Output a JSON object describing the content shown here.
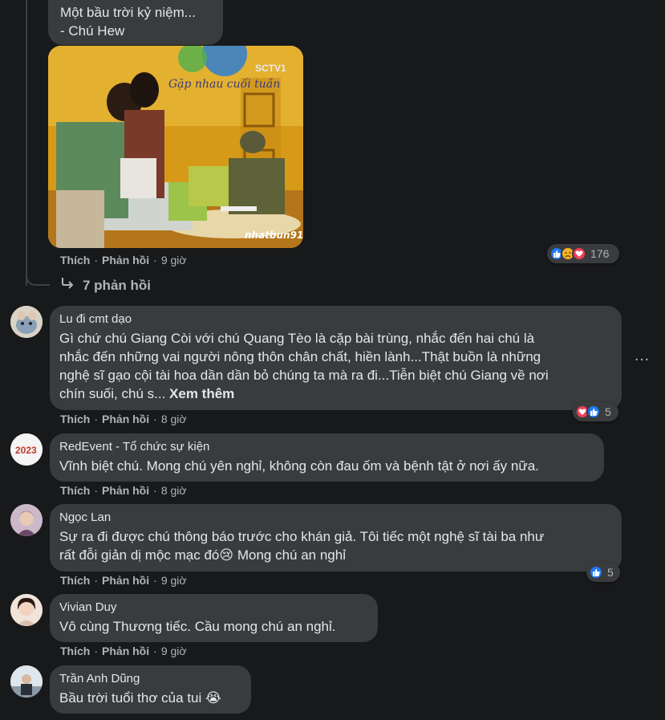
{
  "top_comment": {
    "text_line1": "Một bầu trời kỷ niệm...",
    "text_line2": "- Chú Hew",
    "video_watermark_top": "Gặp nhau cuối tuần",
    "video_channel": "SCTV1",
    "video_watermark": "nhatbun91",
    "actions": {
      "like": "Thích",
      "reply": "Phản hồi",
      "time": "9 giờ"
    },
    "reaction_count": "176"
  },
  "replies_toggle": {
    "label": "7 phản hồi"
  },
  "comments": [
    {
      "author": "Lu đi cmt dạo",
      "lines": [
        "Gì chứ chú Giang Còi với chú Quang Tèo là cặp bài trùng, nhắc đến hai chú là",
        "nhắc đến những vai người nông thôn chân chất, hiền lành...Thật buồn là những",
        "nghệ sĩ gạo cội tài hoa dần dần bỏ chúng ta mà ra đi...Tiễn biệt chú Giang về nơi",
        "chín suối, chú s..."
      ],
      "see_more": "Xem thêm",
      "time": "8 giờ",
      "reaction_count": "5",
      "more_icon": "…"
    },
    {
      "author": "RedEvent - Tổ chức sự kiện",
      "lines": [
        "Vĩnh biệt chú. Mong chú yên nghỉ, không còn đau ốm và bệnh tật ở nơi ấy nữa."
      ],
      "time": "8 giờ"
    },
    {
      "author": "Ngọc Lan",
      "lines": [
        "Sự ra đi được chú thông báo trước cho khán giả. Tôi tiếc một nghệ sĩ tài ba như",
        "rất đỗi giản dị mộc mạc đó😢 Mong chú an nghỉ"
      ],
      "time": "9 giờ",
      "reaction_count": "5"
    },
    {
      "author": "Vivian Duy",
      "lines": [
        "Vô cùng Thương tiếc. Cầu mong chú an nghỉ."
      ],
      "time": "9 giờ"
    },
    {
      "author": "Trần Anh Dũng",
      "lines": [
        "Bầu trời tuổi thơ của tui 😭"
      ]
    }
  ],
  "labels": {
    "like": "Thích",
    "reply": "Phản hồi"
  },
  "colors": {
    "background": "#18191a",
    "bubble": "#3a3b3c",
    "secondary_text": "#b0b3b8",
    "like_blue": "#2078f4",
    "love_red": "#f33e58"
  }
}
